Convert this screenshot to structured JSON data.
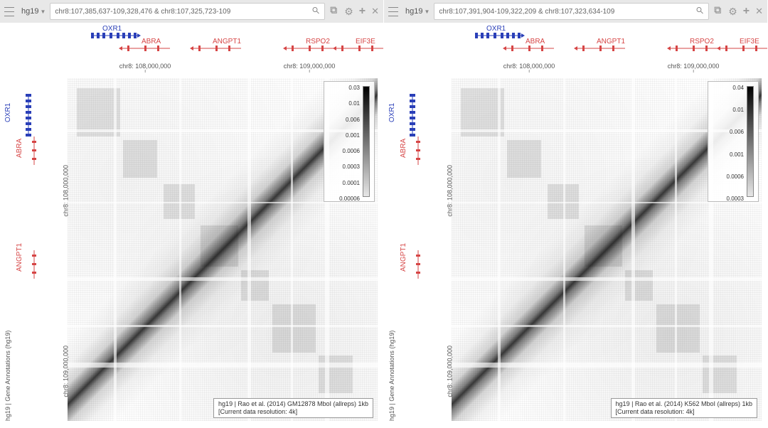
{
  "panels": [
    {
      "assembly": "hg19",
      "coord_display": "chr8:107,385,637-109,328,476 & chr8:107,325,723-109",
      "genes_top": {
        "blue": [
          {
            "name": "OXR1",
            "x_pct": 7,
            "w_pct": 18
          }
        ],
        "red": [
          {
            "name": "ABRA",
            "x_pct": 17,
            "w_pct": 1
          },
          {
            "name": "ANGPT1",
            "x_pct": 40,
            "w_pct": 10
          },
          {
            "name": "RSPO2",
            "x_pct": 70,
            "w_pct": 8
          },
          {
            "name": "EIF3E",
            "x_pct": 86,
            "w_pct": 5
          }
        ]
      },
      "axis_top": {
        "ticks": [
          {
            "label": "chr8: 108,000,000",
            "pct": 25
          },
          {
            "label": "chr8: 109,000,000",
            "pct": 78
          }
        ]
      },
      "axis_left": {
        "ticks": [
          {
            "label": "chr8: 108,000,000",
            "pct": 25
          },
          {
            "label": "chr8: 109,000,000",
            "pct": 78
          }
        ],
        "track_label": "hg19 | Gene Annotations (hg19)"
      },
      "genes_left": {
        "blue": [
          {
            "name": "OXR1",
            "y_pct": 6
          }
        ],
        "red": [
          {
            "name": "ABRA",
            "y_pct": 18
          },
          {
            "name": "ANGPT1",
            "y_pct": 50
          }
        ]
      },
      "colorbar_ticks": [
        "0.03",
        "0.01",
        "0.006",
        "0.001",
        "0.0006",
        "0.0003",
        "0.0001",
        "0.00006"
      ],
      "dataset_line1": "hg19 | Rao et al. (2014) GM12878 MboI (allreps) 1kb",
      "dataset_line2": "[Current data resolution: 4k]"
    },
    {
      "assembly": "hg19",
      "coord_display": "chr8:107,391,904-109,322,209 & chr8:107,323,634-109",
      "genes_top": {
        "blue": [
          {
            "name": "OXR1",
            "x_pct": 7,
            "w_pct": 18
          }
        ],
        "red": [
          {
            "name": "ABRA",
            "x_pct": 17,
            "w_pct": 1
          },
          {
            "name": "ANGPT1",
            "x_pct": 40,
            "w_pct": 10
          },
          {
            "name": "RSPO2",
            "x_pct": 70,
            "w_pct": 8
          },
          {
            "name": "EIF3E",
            "x_pct": 86,
            "w_pct": 5
          }
        ]
      },
      "axis_top": {
        "ticks": [
          {
            "label": "chr8: 108,000,000",
            "pct": 25
          },
          {
            "label": "chr8: 109,000,000",
            "pct": 78
          }
        ]
      },
      "axis_left": {
        "ticks": [
          {
            "label": "chr8: 108,000,000",
            "pct": 25
          },
          {
            "label": "chr8: 109,000,000",
            "pct": 78
          }
        ],
        "track_label": "hg19 | Gene Annotations (hg19)"
      },
      "genes_left": {
        "blue": [
          {
            "name": "OXR1",
            "y_pct": 6
          }
        ],
        "red": [
          {
            "name": "ABRA",
            "y_pct": 18
          },
          {
            "name": "ANGPT1",
            "y_pct": 50
          }
        ]
      },
      "colorbar_ticks": [
        "0.04",
        "0.01",
        "0.006",
        "0.001",
        "0.0006",
        "0.0003"
      ],
      "dataset_line1": "hg19 | Rao et al. (2014) K562 MboI (allreps) 1kb",
      "dataset_line2": "[Current data resolution: 4k]"
    }
  ],
  "chart_data": [
    {
      "type": "heatmap",
      "title": "Hi-C contact matrix — GM12878",
      "dataset": "Rao et al. (2014) GM12878 MboI (allreps) 1kb",
      "assembly": "hg19",
      "x_range": {
        "chrom": "chr8",
        "start": 107385637,
        "end": 109328476
      },
      "y_range": {
        "chrom": "chr8",
        "start": 107325723,
        "end": 109328476
      },
      "resolution_bp": 4000,
      "colorbar": {
        "scale": "log",
        "ticks": [
          0.03,
          0.01,
          0.006,
          0.001,
          0.0006,
          0.0003,
          0.0001,
          6e-05
        ]
      },
      "genes_plus_strand": [
        "OXR1"
      ],
      "genes_minus_strand": [
        "ABRA",
        "ANGPT1",
        "RSPO2",
        "EIF3E"
      ],
      "axis_ticks_bp": [
        108000000,
        109000000
      ]
    },
    {
      "type": "heatmap",
      "title": "Hi-C contact matrix — K562",
      "dataset": "Rao et al. (2014) K562 MboI (allreps) 1kb",
      "assembly": "hg19",
      "x_range": {
        "chrom": "chr8",
        "start": 107391904,
        "end": 109322209
      },
      "y_range": {
        "chrom": "chr8",
        "start": 107323634,
        "end": 109322209
      },
      "resolution_bp": 4000,
      "colorbar": {
        "scale": "log",
        "ticks": [
          0.04,
          0.01,
          0.006,
          0.001,
          0.0006,
          0.0003
        ]
      },
      "genes_plus_strand": [
        "OXR1"
      ],
      "genes_minus_strand": [
        "ABRA",
        "ANGPT1",
        "RSPO2",
        "EIF3E"
      ],
      "axis_ticks_bp": [
        108000000,
        109000000
      ]
    }
  ]
}
